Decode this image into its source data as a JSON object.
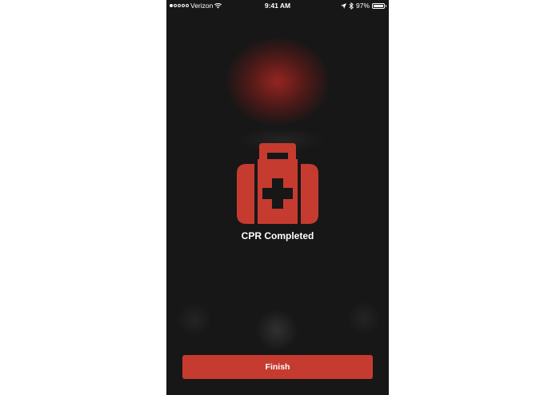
{
  "status_bar": {
    "carrier": "Verizon",
    "time": "9:41 AM",
    "battery": "97%",
    "battery_level": 0.97,
    "signal_bars": 1
  },
  "main": {
    "icon": "first-aid-kit-icon",
    "status_text": "CPR Completed"
  },
  "actions": {
    "finish_label": "Finish"
  },
  "colors": {
    "background": "#171717",
    "accent": "#c63b2f",
    "text": "#ffffff"
  }
}
